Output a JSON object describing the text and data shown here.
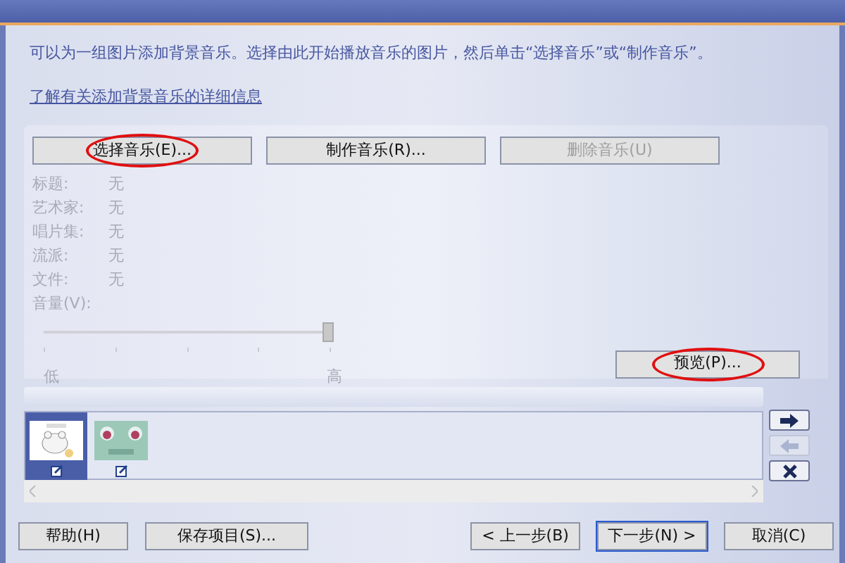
{
  "intro": "可以为一组图片添加背景音乐。选择由此开始播放音乐的图片，然后单击“选择音乐”或“制作音乐”。",
  "link": "了解有关添加背景音乐的详细信息",
  "music_buttons": [
    {
      "label": "选择音乐(E)...",
      "disabled": false,
      "circled": true
    },
    {
      "label": "制作音乐(R)...",
      "disabled": false,
      "circled": false
    },
    {
      "label": "删除音乐(U)",
      "disabled": true,
      "circled": false
    }
  ],
  "properties": [
    {
      "label": "标题:",
      "value": "无"
    },
    {
      "label": "艺术家:",
      "value": "无"
    },
    {
      "label": "唱片集:",
      "value": "无"
    },
    {
      "label": "流派:",
      "value": "无"
    },
    {
      "label": "文件:",
      "value": "无"
    }
  ],
  "volume": {
    "label": "音量(V):",
    "level": 1,
    "low": "低",
    "high": "高"
  },
  "preview_button": {
    "label": "预览(P)...",
    "circled": true
  },
  "thumbnails": [
    {
      "selected": true
    },
    {
      "selected": false
    }
  ],
  "side_buttons": [
    {
      "kind": "right",
      "disabled": false
    },
    {
      "kind": "left",
      "disabled": true
    },
    {
      "kind": "remove",
      "disabled": false
    }
  ],
  "footer_buttons": [
    {
      "label": "帮助(H)",
      "default": false
    },
    {
      "label": "保存项目(S)...",
      "default": false
    },
    {
      "label": "< 上一步(B)",
      "default": false
    },
    {
      "label": "下一步(N) >",
      "default": true
    },
    {
      "label": "取消(C)",
      "default": false
    }
  ]
}
